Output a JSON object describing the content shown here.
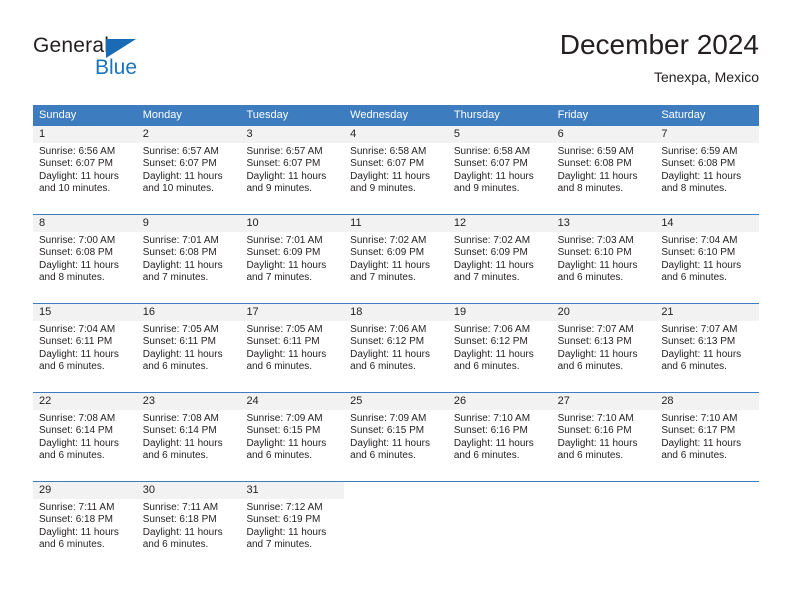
{
  "brand": {
    "name_part1": "General",
    "name_part2": "Blue",
    "accent_color": "#1b75bc",
    "triangle_color": "#1a6bb5"
  },
  "header": {
    "title": "December 2024",
    "subtitle": "Tenexpa, Mexico"
  },
  "calendar": {
    "header_bg": "#3c7cbf",
    "day_band_bg": "#f2f2f2",
    "weekdays": [
      "Sunday",
      "Monday",
      "Tuesday",
      "Wednesday",
      "Thursday",
      "Friday",
      "Saturday"
    ],
    "weeks": [
      [
        {
          "day": "1",
          "sunrise": "Sunrise: 6:56 AM",
          "sunset": "Sunset: 6:07 PM",
          "daylight_line1": "Daylight: 11 hours",
          "daylight_line2": "and 10 minutes."
        },
        {
          "day": "2",
          "sunrise": "Sunrise: 6:57 AM",
          "sunset": "Sunset: 6:07 PM",
          "daylight_line1": "Daylight: 11 hours",
          "daylight_line2": "and 10 minutes."
        },
        {
          "day": "3",
          "sunrise": "Sunrise: 6:57 AM",
          "sunset": "Sunset: 6:07 PM",
          "daylight_line1": "Daylight: 11 hours",
          "daylight_line2": "and 9 minutes."
        },
        {
          "day": "4",
          "sunrise": "Sunrise: 6:58 AM",
          "sunset": "Sunset: 6:07 PM",
          "daylight_line1": "Daylight: 11 hours",
          "daylight_line2": "and 9 minutes."
        },
        {
          "day": "5",
          "sunrise": "Sunrise: 6:58 AM",
          "sunset": "Sunset: 6:07 PM",
          "daylight_line1": "Daylight: 11 hours",
          "daylight_line2": "and 9 minutes."
        },
        {
          "day": "6",
          "sunrise": "Sunrise: 6:59 AM",
          "sunset": "Sunset: 6:08 PM",
          "daylight_line1": "Daylight: 11 hours",
          "daylight_line2": "and 8 minutes."
        },
        {
          "day": "7",
          "sunrise": "Sunrise: 6:59 AM",
          "sunset": "Sunset: 6:08 PM",
          "daylight_line1": "Daylight: 11 hours",
          "daylight_line2": "and 8 minutes."
        }
      ],
      [
        {
          "day": "8",
          "sunrise": "Sunrise: 7:00 AM",
          "sunset": "Sunset: 6:08 PM",
          "daylight_line1": "Daylight: 11 hours",
          "daylight_line2": "and 8 minutes."
        },
        {
          "day": "9",
          "sunrise": "Sunrise: 7:01 AM",
          "sunset": "Sunset: 6:08 PM",
          "daylight_line1": "Daylight: 11 hours",
          "daylight_line2": "and 7 minutes."
        },
        {
          "day": "10",
          "sunrise": "Sunrise: 7:01 AM",
          "sunset": "Sunset: 6:09 PM",
          "daylight_line1": "Daylight: 11 hours",
          "daylight_line2": "and 7 minutes."
        },
        {
          "day": "11",
          "sunrise": "Sunrise: 7:02 AM",
          "sunset": "Sunset: 6:09 PM",
          "daylight_line1": "Daylight: 11 hours",
          "daylight_line2": "and 7 minutes."
        },
        {
          "day": "12",
          "sunrise": "Sunrise: 7:02 AM",
          "sunset": "Sunset: 6:09 PM",
          "daylight_line1": "Daylight: 11 hours",
          "daylight_line2": "and 7 minutes."
        },
        {
          "day": "13",
          "sunrise": "Sunrise: 7:03 AM",
          "sunset": "Sunset: 6:10 PM",
          "daylight_line1": "Daylight: 11 hours",
          "daylight_line2": "and 6 minutes."
        },
        {
          "day": "14",
          "sunrise": "Sunrise: 7:04 AM",
          "sunset": "Sunset: 6:10 PM",
          "daylight_line1": "Daylight: 11 hours",
          "daylight_line2": "and 6 minutes."
        }
      ],
      [
        {
          "day": "15",
          "sunrise": "Sunrise: 7:04 AM",
          "sunset": "Sunset: 6:11 PM",
          "daylight_line1": "Daylight: 11 hours",
          "daylight_line2": "and 6 minutes."
        },
        {
          "day": "16",
          "sunrise": "Sunrise: 7:05 AM",
          "sunset": "Sunset: 6:11 PM",
          "daylight_line1": "Daylight: 11 hours",
          "daylight_line2": "and 6 minutes."
        },
        {
          "day": "17",
          "sunrise": "Sunrise: 7:05 AM",
          "sunset": "Sunset: 6:11 PM",
          "daylight_line1": "Daylight: 11 hours",
          "daylight_line2": "and 6 minutes."
        },
        {
          "day": "18",
          "sunrise": "Sunrise: 7:06 AM",
          "sunset": "Sunset: 6:12 PM",
          "daylight_line1": "Daylight: 11 hours",
          "daylight_line2": "and 6 minutes."
        },
        {
          "day": "19",
          "sunrise": "Sunrise: 7:06 AM",
          "sunset": "Sunset: 6:12 PM",
          "daylight_line1": "Daylight: 11 hours",
          "daylight_line2": "and 6 minutes."
        },
        {
          "day": "20",
          "sunrise": "Sunrise: 7:07 AM",
          "sunset": "Sunset: 6:13 PM",
          "daylight_line1": "Daylight: 11 hours",
          "daylight_line2": "and 6 minutes."
        },
        {
          "day": "21",
          "sunrise": "Sunrise: 7:07 AM",
          "sunset": "Sunset: 6:13 PM",
          "daylight_line1": "Daylight: 11 hours",
          "daylight_line2": "and 6 minutes."
        }
      ],
      [
        {
          "day": "22",
          "sunrise": "Sunrise: 7:08 AM",
          "sunset": "Sunset: 6:14 PM",
          "daylight_line1": "Daylight: 11 hours",
          "daylight_line2": "and 6 minutes."
        },
        {
          "day": "23",
          "sunrise": "Sunrise: 7:08 AM",
          "sunset": "Sunset: 6:14 PM",
          "daylight_line1": "Daylight: 11 hours",
          "daylight_line2": "and 6 minutes."
        },
        {
          "day": "24",
          "sunrise": "Sunrise: 7:09 AM",
          "sunset": "Sunset: 6:15 PM",
          "daylight_line1": "Daylight: 11 hours",
          "daylight_line2": "and 6 minutes."
        },
        {
          "day": "25",
          "sunrise": "Sunrise: 7:09 AM",
          "sunset": "Sunset: 6:15 PM",
          "daylight_line1": "Daylight: 11 hours",
          "daylight_line2": "and 6 minutes."
        },
        {
          "day": "26",
          "sunrise": "Sunrise: 7:10 AM",
          "sunset": "Sunset: 6:16 PM",
          "daylight_line1": "Daylight: 11 hours",
          "daylight_line2": "and 6 minutes."
        },
        {
          "day": "27",
          "sunrise": "Sunrise: 7:10 AM",
          "sunset": "Sunset: 6:16 PM",
          "daylight_line1": "Daylight: 11 hours",
          "daylight_line2": "and 6 minutes."
        },
        {
          "day": "28",
          "sunrise": "Sunrise: 7:10 AM",
          "sunset": "Sunset: 6:17 PM",
          "daylight_line1": "Daylight: 11 hours",
          "daylight_line2": "and 6 minutes."
        }
      ],
      [
        {
          "day": "29",
          "sunrise": "Sunrise: 7:11 AM",
          "sunset": "Sunset: 6:18 PM",
          "daylight_line1": "Daylight: 11 hours",
          "daylight_line2": "and 6 minutes."
        },
        {
          "day": "30",
          "sunrise": "Sunrise: 7:11 AM",
          "sunset": "Sunset: 6:18 PM",
          "daylight_line1": "Daylight: 11 hours",
          "daylight_line2": "and 6 minutes."
        },
        {
          "day": "31",
          "sunrise": "Sunrise: 7:12 AM",
          "sunset": "Sunset: 6:19 PM",
          "daylight_line1": "Daylight: 11 hours",
          "daylight_line2": "and 7 minutes."
        },
        {
          "day": "",
          "sunrise": "",
          "sunset": "",
          "daylight_line1": "",
          "daylight_line2": ""
        },
        {
          "day": "",
          "sunrise": "",
          "sunset": "",
          "daylight_line1": "",
          "daylight_line2": ""
        },
        {
          "day": "",
          "sunrise": "",
          "sunset": "",
          "daylight_line1": "",
          "daylight_line2": ""
        },
        {
          "day": "",
          "sunrise": "",
          "sunset": "",
          "daylight_line1": "",
          "daylight_line2": ""
        }
      ]
    ]
  }
}
